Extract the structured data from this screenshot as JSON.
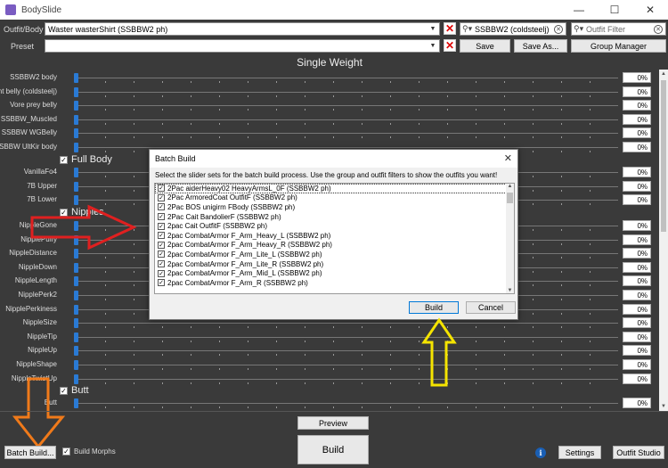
{
  "window": {
    "title": "BodySlide",
    "minimize": "—",
    "maximize": "☐",
    "close": "✕"
  },
  "top": {
    "outfit_label": "Outfit/Body",
    "outfit_value": "Waster wasterShirt (SSBBW2 ph)",
    "preset_label": "Preset",
    "preset_value": "",
    "group_filter_value": "SSBBW2 (coldsteelj)",
    "outfit_filter_placeholder": "Outfit Filter",
    "save_label": "Save",
    "save_as_label": "Save As...",
    "group_manager_label": "Group Manager"
  },
  "section_title": "Single Weight",
  "sliders_top": [
    {
      "label": "SSBBW2 body",
      "value": "0%"
    },
    {
      "label": "Giant belly (coldsteelj)",
      "value": "0%"
    },
    {
      "label": "Vore prey belly",
      "value": "0%"
    },
    {
      "label": "SSBBW_Muscled",
      "value": "0%"
    },
    {
      "label": "SSBBW WGBelly",
      "value": "0%"
    },
    {
      "label": "SSBBW UltKir body",
      "value": "0%"
    }
  ],
  "group_full_body": "Full Body",
  "sliders_full": [
    {
      "label": "VanillaFo4",
      "value": "0%"
    },
    {
      "label": "7B Upper",
      "value": "0%"
    },
    {
      "label": "7B Lower",
      "value": "0%"
    }
  ],
  "group_nipples": "Nipples",
  "sliders_nipples": [
    {
      "label": "NippleGone",
      "value": "0%"
    },
    {
      "label": "NipplePuffy",
      "value": "0%"
    },
    {
      "label": "NippleDistance",
      "value": "0%"
    },
    {
      "label": "NippleDown",
      "value": "0%"
    },
    {
      "label": "NippleLength",
      "value": "0%"
    },
    {
      "label": "NipplePerk2",
      "value": "0%"
    },
    {
      "label": "NipplePerkiness",
      "value": "0%"
    },
    {
      "label": "NippleSize",
      "value": "0%"
    },
    {
      "label": "NippleTip",
      "value": "0%"
    },
    {
      "label": "NippleUp",
      "value": "0%"
    },
    {
      "label": "NippleShape",
      "value": "0%"
    },
    {
      "label": "NippleTwistUp",
      "value": "0%"
    }
  ],
  "group_butt": "Butt",
  "sliders_butt": [
    {
      "label": "Butt",
      "value": "0%"
    }
  ],
  "dialog": {
    "title": "Batch Build",
    "close": "✕",
    "instructions": "Select the slider sets for the batch build process. Use the group and outfit filters to show the outfits you want!",
    "items": [
      "2Pac aiderHeavy02 HeavyArmsL_0F (SSBBW2 ph)",
      "2Pac ArmoredCoat OutfitF (SSBBW2 ph)",
      "2Pac BOS unigirm FBody (SSBBW2 ph)",
      "2Pac Cait BandolierF (SSBBW2 ph)",
      "2pac Cait OutfitF (SSBBW2 ph)",
      "2pac CombatArmor F_Arm_Heavy_L (SSBBW2 ph)",
      "2pac CombatArmor F_Arm_Heavy_R (SSBBW2 ph)",
      "2pac CombatArmor F_Arm_Lite_L (SSBBW2 ph)",
      "2pac CombatArmor F_Arm_Lite_R (SSBBW2 ph)",
      "2pac CombatArmor F_Arm_Mid_L (SSBBW2 ph)",
      "2pac CombatArmor F_Arm_R (SSBBW2 ph)"
    ],
    "build_label": "Build",
    "cancel_label": "Cancel"
  },
  "bottom": {
    "batch_build_label": "Batch Build...",
    "build_morphs_label": "Build Morphs",
    "preview_label": "Preview",
    "build_label": "Build",
    "info_glyph": "i",
    "settings_label": "Settings",
    "outfit_studio_label": "Outfit Studio"
  },
  "colors": {
    "red_arrow": "#e02020",
    "yellow_arrow": "#f5e400",
    "orange_arrow": "#f07a1a",
    "slider_thumb": "#2a7ad4"
  }
}
